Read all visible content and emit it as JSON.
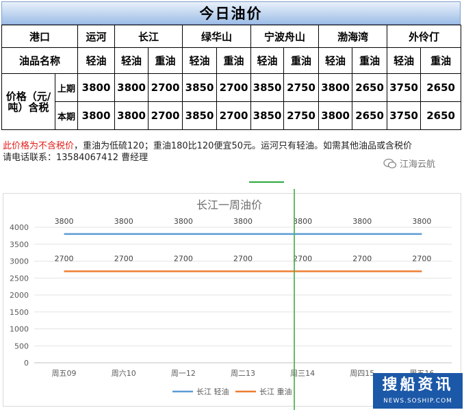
{
  "table": {
    "title": "今日油价",
    "port_header": "港口",
    "ports": [
      "运河",
      "长江",
      "绿华山",
      "宁波舟山",
      "渤海湾",
      "外伶仃"
    ],
    "oil_header": "油品名称",
    "oil_names": [
      "轻油",
      "轻油",
      "重油",
      "轻油",
      "重油",
      "轻油",
      "重油",
      "轻油",
      "重油",
      "轻油",
      "重油"
    ],
    "price_label_line1": "价格（元/",
    "price_label_line2": "吨）含税",
    "rows": [
      {
        "period": "上期",
        "values": [
          "3800",
          "3800",
          "2700",
          "3850",
          "2700",
          "3850",
          "2750",
          "3800",
          "2650",
          "3750",
          "2650"
        ]
      },
      {
        "period": "本期",
        "values": [
          "3800",
          "3800",
          "2700",
          "3850",
          "2700",
          "3850",
          "2750",
          "3800",
          "2650",
          "3750",
          "2650"
        ]
      }
    ]
  },
  "note": {
    "red_part": "此价格为不含税价",
    "rest_line1": "，重油为低硫120；重油180比120便宜50元。运河只有轻油。如需其他油品或含税价",
    "line2": "请电话联系：13584067412   曹经理"
  },
  "watermark_top": "江海云航",
  "badge": {
    "big": "搜船资讯",
    "small": "NEWS.SOSHIP.COM"
  },
  "chart_data": {
    "type": "line",
    "title": "长江一周油价",
    "categories": [
      "周五09",
      "周六10",
      "周一12",
      "周二13",
      "周三14",
      "周四15",
      "周五16"
    ],
    "series": [
      {
        "name": "长江 轻油",
        "values": [
          3800,
          3800,
          3800,
          3800,
          3800,
          3800,
          3800
        ],
        "color": "#5b9bd5"
      },
      {
        "name": "长江 重油",
        "values": [
          2700,
          2700,
          2700,
          2700,
          2700,
          2700,
          2700
        ],
        "color": "#ed7d31"
      }
    ],
    "ylim": [
      0,
      4000
    ],
    "yticks": [
      0,
      500,
      1000,
      1500,
      2000,
      2500,
      3000,
      3500,
      4000
    ],
    "grid": true,
    "legend": "bottom"
  }
}
